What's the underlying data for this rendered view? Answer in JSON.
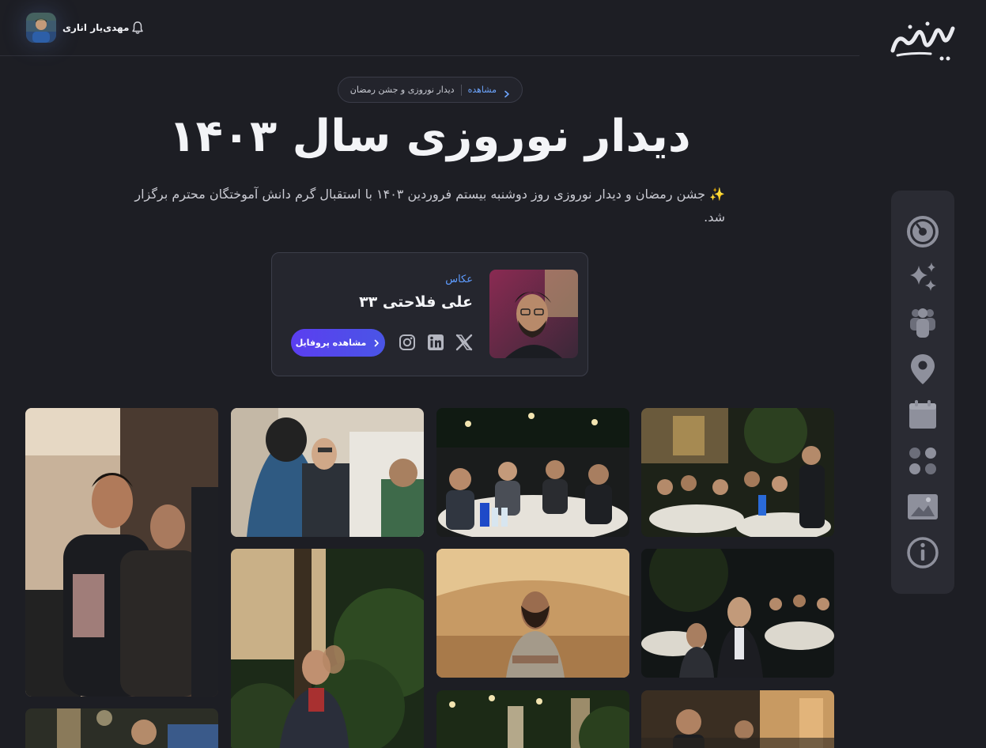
{
  "header": {
    "user_name": "مهدی‌یار اناری",
    "logo_text": "نیک‌نوروز"
  },
  "breadcrumb": {
    "link_label": "مشاهده",
    "current": "دیدار نوروزی و جشن رمضان"
  },
  "page": {
    "title": "دیدار نوروزی سال ۱۴۰۳",
    "description_emoji": "✨",
    "description": "جشن رمضان و دیدار نوروزی روز دوشنبه بیستم فروردین ۱۴۰۳ با استقبال گرم دانش آموختگان محترم برگزار شد."
  },
  "photographer": {
    "role": "عکاس",
    "name": "علی فلاحتی ۳۳",
    "profile_button": "مشاهده پروفایل",
    "socials": [
      "x-icon",
      "linkedin-icon",
      "instagram-icon"
    ]
  },
  "sidebar": {
    "items": [
      "dashboard-icon",
      "sparkles-icon",
      "people-icon",
      "location-icon",
      "calendar-icon",
      "apps-icon",
      "gallery-icon",
      "info-icon"
    ]
  },
  "gallery": {
    "photos": [
      "photo-guests-talking-brick-wall",
      "photo-man-in-suit-conversation",
      "photo-dinner-tables-crowd",
      "photo-outdoor-dinner-garden",
      "photo-man-smiling-indoor",
      "photo-man-smiling-arms-crossed",
      "photo-guests-standing-night",
      "photo-older-man-garden",
      "photo-garden-lights",
      "photo-young-man-outdoor",
      "photo-building-entrance-crowd"
    ]
  },
  "colors": {
    "background": "#1d1e24",
    "accent": "#5e9cff",
    "button": "#5b3ef0",
    "sidebar": "#2a2b33"
  }
}
